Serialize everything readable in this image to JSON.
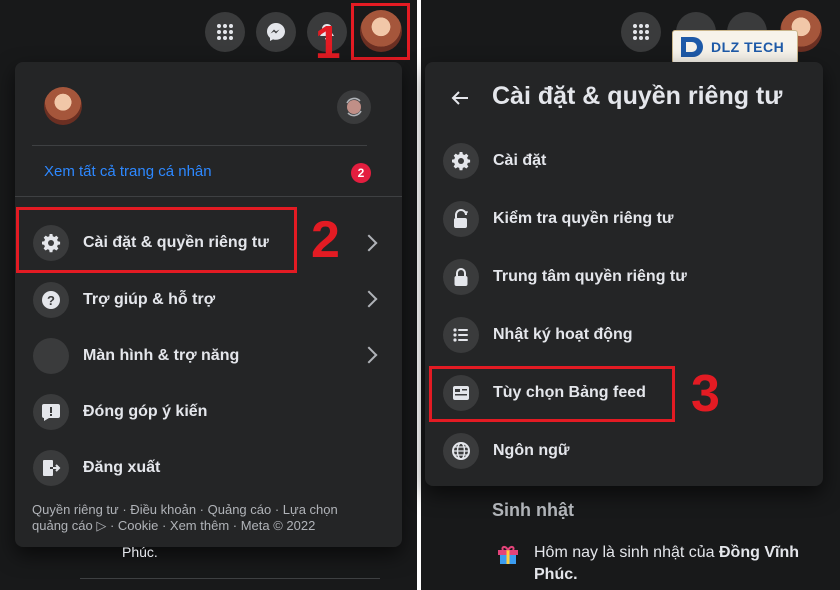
{
  "left": {
    "profile_link": "Xem tất cả trang cá nhân",
    "badge_count": "2",
    "items": [
      {
        "label": "Cài đặt & quyền riêng tư",
        "icon": "gear-icon"
      },
      {
        "label": "Trợ giúp & hỗ trợ",
        "icon": "help-icon"
      },
      {
        "label": "Màn hình & trợ năng",
        "icon": "moon-icon"
      },
      {
        "label": "Đóng góp ý kiến",
        "icon": "feedback-icon"
      },
      {
        "label": "Đăng xuất",
        "icon": "logout-icon"
      }
    ],
    "footer_line1": "Quyền riêng tư · Điều khoản · Quảng cáo · Lựa chọn",
    "footer_line2": "quảng cáo ▷ · Cookie · Xem thêm · Meta © 2022",
    "behind_text": "Phúc."
  },
  "right": {
    "title": "Cài đặt & quyền riêng tư",
    "items": [
      {
        "label": "Cài đặt",
        "icon": "gear-icon"
      },
      {
        "label": "Kiểm tra quyền riêng tư",
        "icon": "lock-heart-icon"
      },
      {
        "label": "Trung tâm quyền riêng tư",
        "icon": "lock-icon"
      },
      {
        "label": "Nhật ký hoạt động",
        "icon": "list-icon"
      },
      {
        "label": "Tùy chọn Bảng feed",
        "icon": "feed-icon"
      },
      {
        "label": "Ngôn ngữ",
        "icon": "globe-icon"
      }
    ],
    "birthday_heading": "Sinh nhật",
    "birthday_text_prefix": "Hôm nay là sinh nhật của ",
    "birthday_name": "Đồng Vĩnh",
    "birthday_text_line2": "Phúc."
  },
  "watermark": {
    "brand": "DLZ TECH"
  },
  "steps": [
    "1",
    "2",
    "3"
  ],
  "colors": {
    "accent_red": "#e31b23",
    "link_blue": "#2d88ff",
    "menu_bg": "#242526",
    "page_bg": "#18191a"
  }
}
